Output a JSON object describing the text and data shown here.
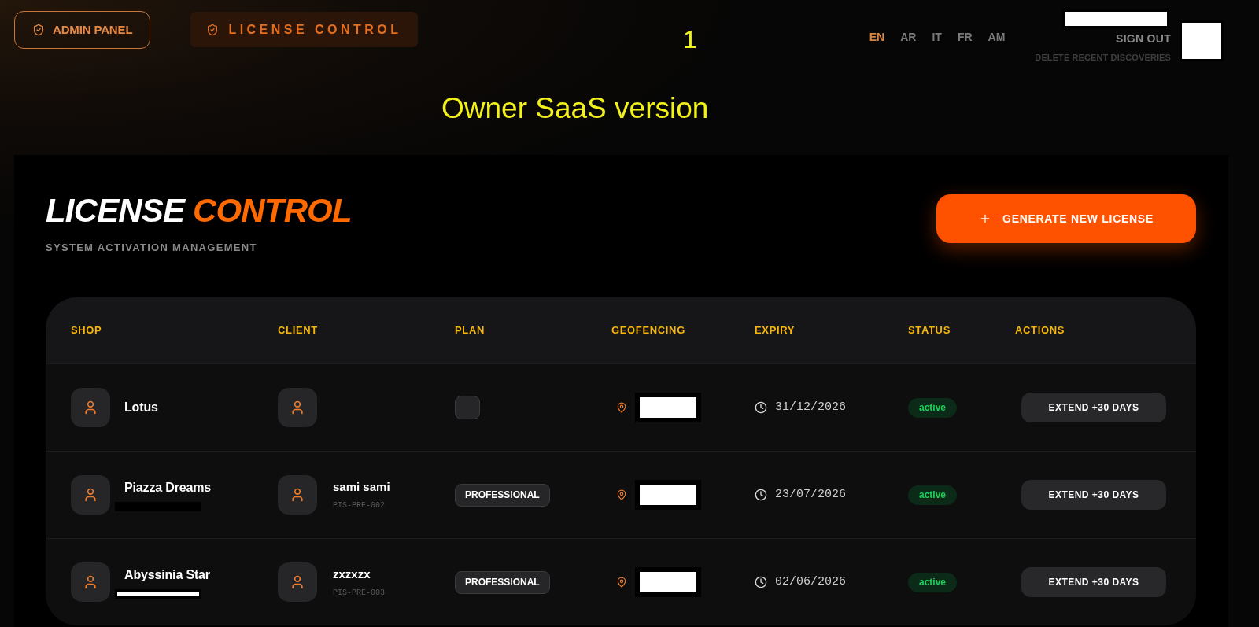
{
  "nav": [
    {
      "label": "ADMIN PANEL",
      "selected": false
    },
    {
      "label": "LICENSE CONTROL",
      "selected": true
    }
  ],
  "overlay_notes": {
    "number": "1",
    "caption": "Owner SaaS version"
  },
  "languages": [
    {
      "label": "EN",
      "selected": true
    },
    {
      "label": "AR",
      "selected": false
    },
    {
      "label": "IT",
      "selected": false
    },
    {
      "label": "FR",
      "selected": false
    },
    {
      "label": "AM",
      "selected": false
    }
  ],
  "account": {
    "name_redacted": true,
    "sign_out": "SIGN OUT",
    "clear_recent": "DELETE RECENT DISCOVERIES",
    "avatar_redacted": true
  },
  "page": {
    "title_lead": "LICENSE",
    "title_accent": "CONTROL",
    "subtitle": "SYSTEM ACTIVATION MANAGEMENT",
    "primary_button": "GENERATE NEW LICENSE"
  },
  "table": {
    "columns": [
      "SHOP",
      "CLIENT",
      "PLAN",
      "GEOFENCING",
      "EXPIRY",
      "STATUS",
      "ACTIONS"
    ],
    "rows": [
      {
        "shop": {
          "name": "Lotus"
        },
        "geofencing": {
          "redacted": true
        },
        "expiry": "31/12/2026",
        "status": "active",
        "action": "EXTEND +30 DAYS"
      },
      {
        "shop": {
          "name": "Piazza Dreams",
          "redaction": {
            "color": "#000000"
          }
        },
        "client": {
          "name": "sami sami",
          "code": "PIS-PRE-002"
        },
        "plan": "PROFESSIONAL",
        "geofencing": {
          "redacted": true
        },
        "expiry": "23/07/2026",
        "status": "active",
        "action": "EXTEND +30 DAYS"
      },
      {
        "shop": {
          "name": "Abyssinia Star",
          "redaction": {
            "color": "#ffffff"
          }
        },
        "client": {
          "name": "zxzxzx",
          "code": "PIS-PRE-003"
        },
        "plan": "PROFESSIONAL",
        "geofencing": {
          "redacted": true
        },
        "expiry": "02/06/2026",
        "status": "active",
        "action": "EXTEND +30 DAYS"
      }
    ]
  }
}
